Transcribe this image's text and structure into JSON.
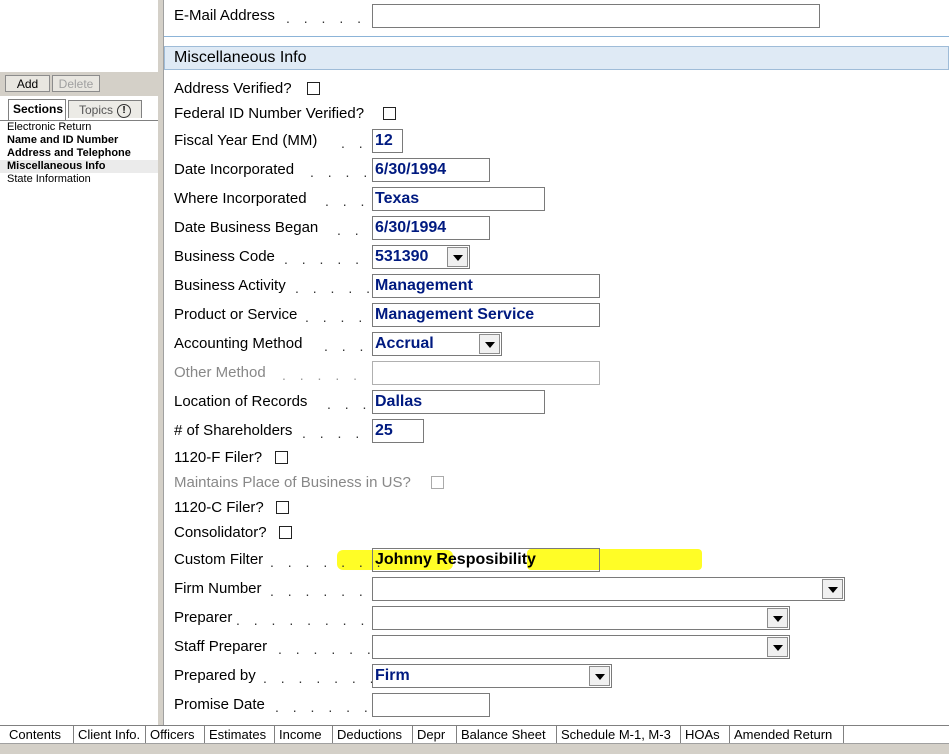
{
  "left_panel": {
    "add_label": "Add",
    "delete_label": "Delete",
    "tabs": {
      "sections": "Sections",
      "topics": "Topics",
      "topics_alert": "!"
    },
    "sections": [
      "Electronic Return",
      "Name and ID Number",
      "Address and Telephone",
      "Miscellaneous Info",
      "State Information"
    ]
  },
  "form": {
    "email_label": "E-Mail Address",
    "email_value": "",
    "misc_header": "Miscellaneous Info",
    "address_verified": "Address Verified?",
    "fed_id_verified": "Federal ID Number Verified?",
    "fiscal_year_end": {
      "label": "Fiscal Year End (MM)",
      "value": "12"
    },
    "date_incorporated": {
      "label": "Date Incorporated",
      "value": "6/30/1994"
    },
    "where_incorporated": {
      "label": "Where Incorporated",
      "value": "Texas"
    },
    "date_business_began": {
      "label": "Date Business Began",
      "value": "6/30/1994"
    },
    "business_code": {
      "label": "Business Code",
      "value": "531390"
    },
    "business_activity": {
      "label": "Business Activity",
      "value": "Management"
    },
    "product_or_service": {
      "label": "Product or Service",
      "value": "Management Service"
    },
    "accounting_method": {
      "label": "Accounting Method",
      "value": "Accrual"
    },
    "other_method": {
      "label": "Other Method",
      "value": ""
    },
    "location_of_records": {
      "label": "Location of Records",
      "value": "Dallas"
    },
    "num_shareholders": {
      "label": "# of Shareholders",
      "value": "25"
    },
    "f1120f_filer": "1120-F Filer?",
    "maintains_place": "Maintains Place of Business in US?",
    "c1120_filer": "1120-C Filer?",
    "consolidator": "Consolidator?",
    "custom_filter": {
      "label": "Custom Filter",
      "value": "Johnny Resposibility"
    },
    "firm_number": {
      "label": "Firm Number",
      "value": ""
    },
    "preparer": {
      "label": "Preparer",
      "value": ""
    },
    "staff_preparer": {
      "label": "Staff Preparer",
      "value": ""
    },
    "prepared_by": {
      "label": "Prepared by",
      "value": "Firm"
    },
    "promise_date": {
      "label": "Promise Date",
      "value": ""
    }
  },
  "bottom_tabs": [
    "Contents",
    "Client Info.",
    "Officers",
    "Estimates",
    "Income",
    "Deductions",
    "Depr",
    "Balance Sheet",
    "Schedule M-1, M-3",
    "HOAs",
    "Amended Return"
  ],
  "colors": {
    "field_text": "#001a80",
    "header_bg": "#dfeaf5",
    "highlight": "#fffd00"
  }
}
